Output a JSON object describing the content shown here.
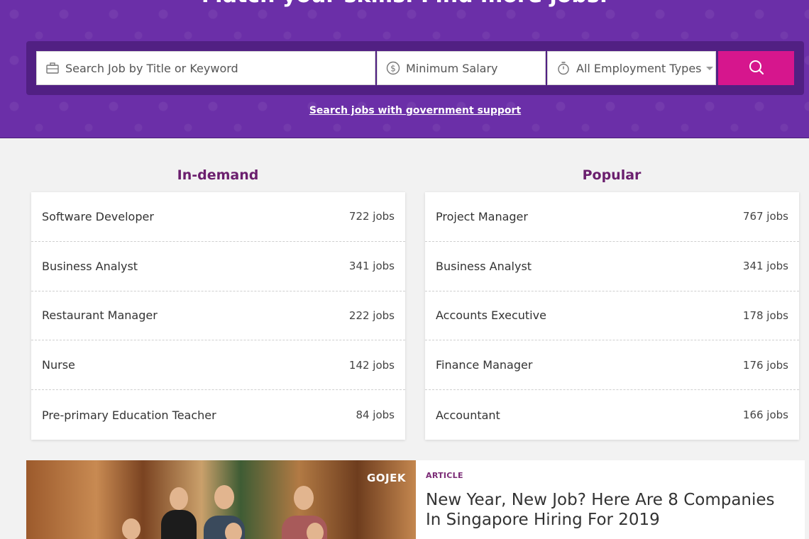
{
  "hero": {
    "title": "Match your skills. Find more jobs.",
    "gov_link": "Search jobs with government support"
  },
  "search": {
    "keyword_placeholder": "Search Job by Title or Keyword",
    "salary_placeholder": "Minimum Salary",
    "employment_type": "All Employment Types",
    "button_icon": "search-icon"
  },
  "in_demand": {
    "heading": "In-demand",
    "items": [
      {
        "name": "Software Developer",
        "count": "722 jobs"
      },
      {
        "name": "Business Analyst",
        "count": "341 jobs"
      },
      {
        "name": "Restaurant Manager",
        "count": "222 jobs"
      },
      {
        "name": "Nurse",
        "count": "142 jobs"
      },
      {
        "name": "Pre-primary Education Teacher",
        "count": "84 jobs"
      }
    ]
  },
  "popular": {
    "heading": "Popular",
    "items": [
      {
        "name": "Project Manager",
        "count": "767 jobs"
      },
      {
        "name": "Business Analyst",
        "count": "341 jobs"
      },
      {
        "name": "Accounts Executive",
        "count": "178 jobs"
      },
      {
        "name": "Finance Manager",
        "count": "176 jobs"
      },
      {
        "name": "Accountant",
        "count": "166 jobs"
      }
    ]
  },
  "article": {
    "tag": "ARTICLE",
    "title": "New Year, New Job? Here Are 8 Companies In Singapore Hiring For 2019",
    "image_logo": "GOJEK"
  },
  "colors": {
    "hero_purple": "#6b2fa8",
    "search_button": "#d6168d",
    "heading_color": "#6b1f6e"
  }
}
